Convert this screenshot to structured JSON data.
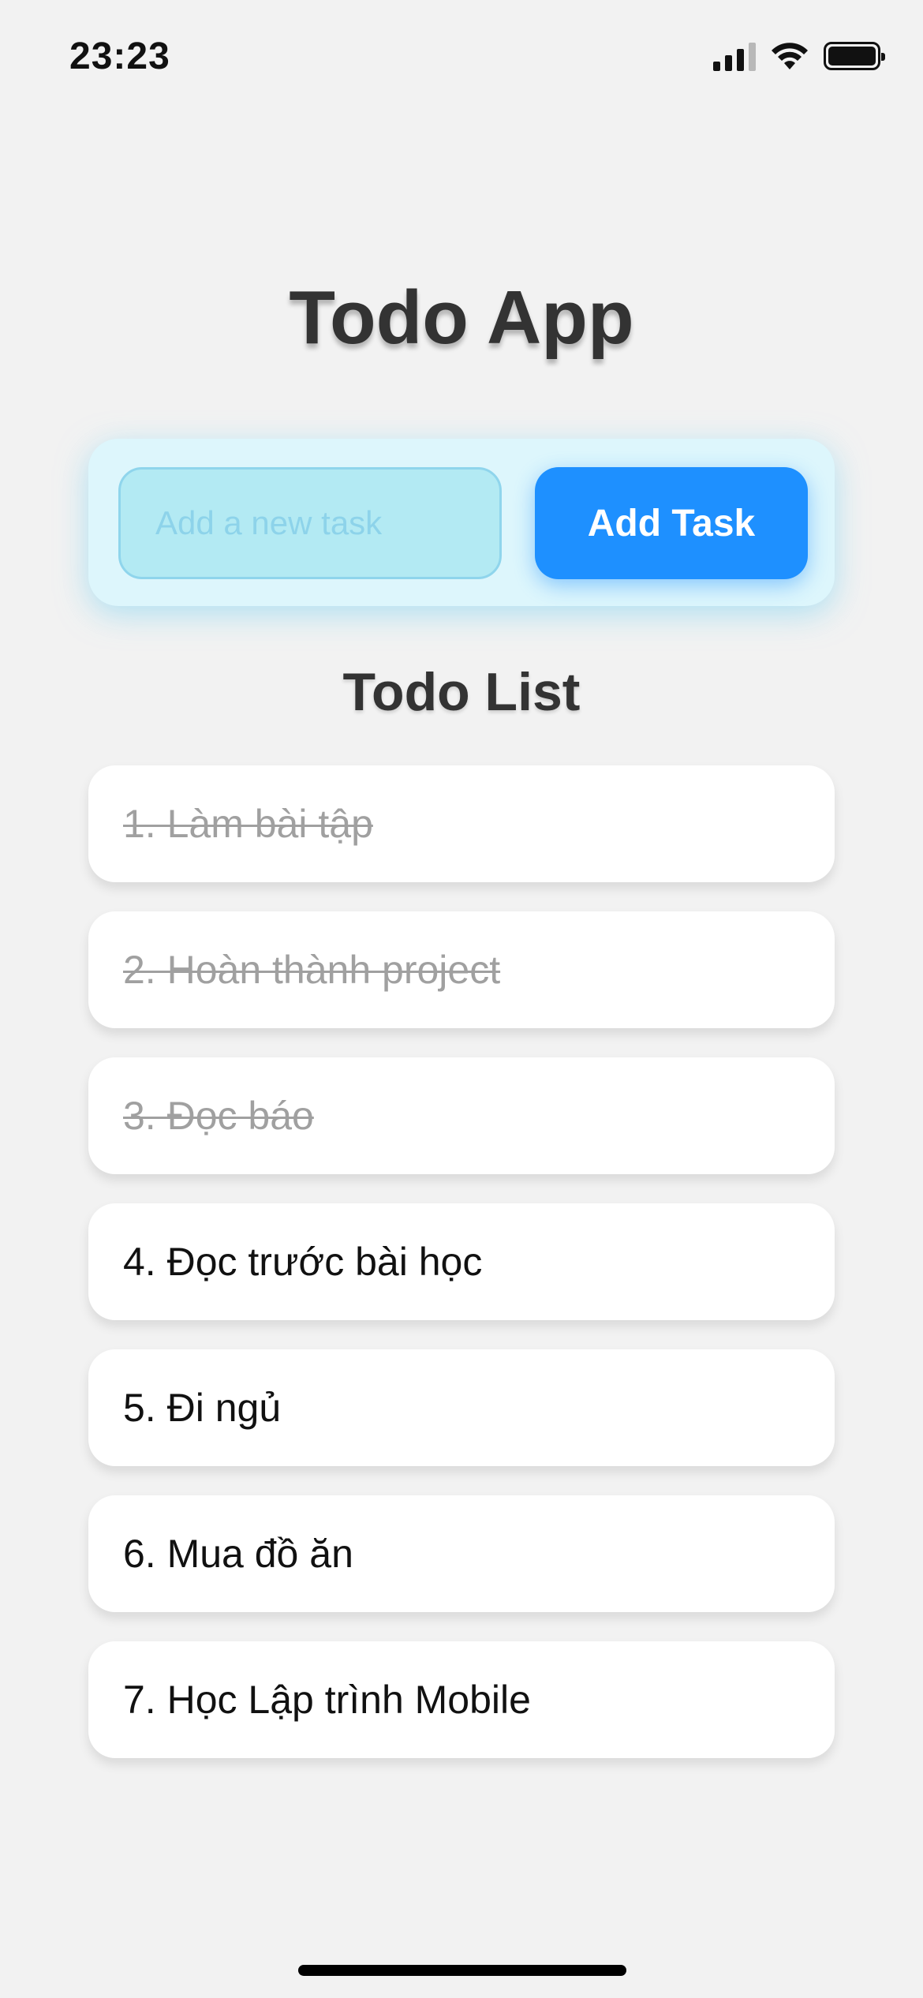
{
  "status_bar": {
    "time": "23:23"
  },
  "app": {
    "title": "Todo App"
  },
  "new_task": {
    "placeholder": "Add a new task",
    "value": "",
    "button_label": "Add Task"
  },
  "list": {
    "title": "Todo List",
    "items": [
      {
        "text": "1. Làm bài tập",
        "completed": true
      },
      {
        "text": "2. Hoàn thành project",
        "completed": true
      },
      {
        "text": "3. Đọc báo",
        "completed": true
      },
      {
        "text": "4. Đọc trước bài học",
        "completed": false
      },
      {
        "text": "5. Đi ngủ",
        "completed": false
      },
      {
        "text": "6. Mua đồ ăn",
        "completed": false
      },
      {
        "text": "7. Học Lập trình Mobile",
        "completed": false
      }
    ]
  },
  "colors": {
    "background": "#f2f2f2",
    "accent": "#1e90ff",
    "input_bg": "#b3eaf3",
    "card_bg": "#ddf6fc",
    "completed_text": "#a0a0a0"
  }
}
